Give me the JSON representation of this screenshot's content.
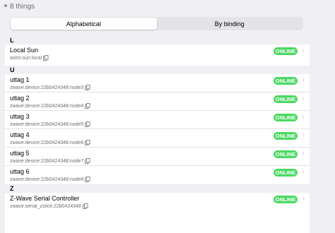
{
  "header": {
    "count_text": "8 things"
  },
  "tabs": [
    {
      "label": "Alphabetical",
      "active": true
    },
    {
      "label": "By binding",
      "active": false
    }
  ],
  "groups": [
    {
      "letter": "L",
      "items": [
        {
          "label": "Local Sun",
          "uid": "astro:sun:local",
          "status": "ONLINE"
        }
      ]
    },
    {
      "letter": "U",
      "items": [
        {
          "label": "uttag 1",
          "uid": "zwave:device:22b0424348:node3",
          "status": "ONLINE"
        },
        {
          "label": "uttag 2",
          "uid": "zwave:device:22b0424348:node4",
          "status": "ONLINE"
        },
        {
          "label": "uttag 3",
          "uid": "zwave:device:22b0424348:node5",
          "status": "ONLINE"
        },
        {
          "label": "uttag 4",
          "uid": "zwave:device:22b0424348:node6",
          "status": "ONLINE"
        },
        {
          "label": "uttag 5",
          "uid": "zwave:device:22b0424348:node7",
          "status": "ONLINE"
        },
        {
          "label": "uttag 6",
          "uid": "zwave:device:22b0424348:node8",
          "status": "ONLINE"
        }
      ]
    },
    {
      "letter": "Z",
      "items": [
        {
          "label": "Z-Wave Serial Controller",
          "uid": "zwave:serial_zstick:22b0424348",
          "status": "ONLINE"
        }
      ]
    }
  ],
  "colors": {
    "online": "#4cd964",
    "background": "#efeff4"
  },
  "icons": {
    "copy": "copy-icon",
    "chevron": "chevron-right-icon"
  }
}
